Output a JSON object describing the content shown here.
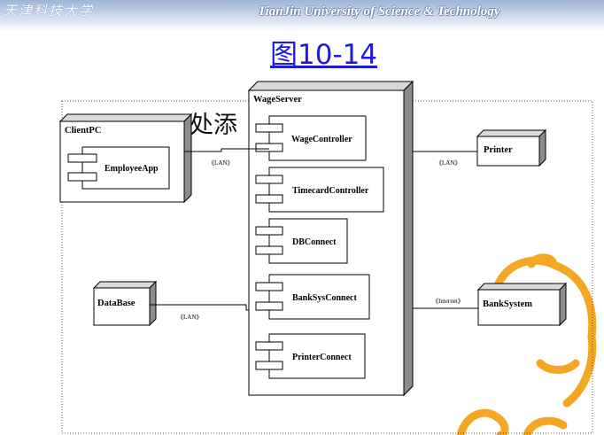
{
  "header": {
    "logo_cn": "天津科技大学",
    "logo_en": "TianJin University of Science & Technology"
  },
  "title": "图10-14",
  "overlay_text": "处添",
  "nodes": {
    "wage_server": "WageServer",
    "client_pc": "ClientPC",
    "printer": "Printer",
    "database": "DataBase",
    "bank_system": "BankSystem"
  },
  "components": {
    "employee_app": "EmployeeApp",
    "wage_controller": "WageController",
    "timecard_controller": "TimecardController",
    "db_connect": "DBConnect",
    "bank_sys_connect": "BankSysConnect",
    "printer_connect": "PrinterConnect"
  },
  "links": {
    "client_lan": "《LAN》",
    "printer_lan": "《LAN》",
    "database_lan": "《LAN》",
    "bank_internet": "《Internet》"
  },
  "colors": {
    "title": "#1c1ce0",
    "mascot": "#f5a623",
    "node_side": "#8c8c8c",
    "node_top": "#d9d9d9"
  }
}
